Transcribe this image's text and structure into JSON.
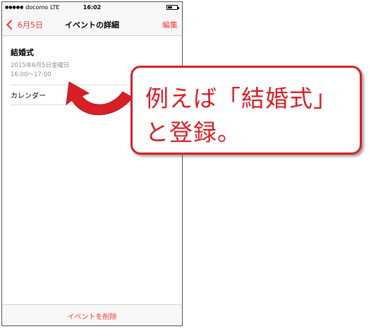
{
  "status_bar": {
    "carrier": "docomo",
    "network": "LTE",
    "time": "16:02"
  },
  "nav": {
    "back_label": "6月5日",
    "title": "イベントの詳細",
    "edit_label": "編集"
  },
  "event": {
    "title": "結婚式",
    "date": "2015年6月5日金曜日",
    "time": "16:00〜17:00",
    "calendar_label": "カレンダー"
  },
  "bottom": {
    "delete_label": "イベントを削除"
  },
  "callout": {
    "line1": "例えば「結婚式」",
    "line2": "と登録。"
  },
  "colors": {
    "accent": "#ef3b37",
    "callout_red": "#d71f26"
  }
}
